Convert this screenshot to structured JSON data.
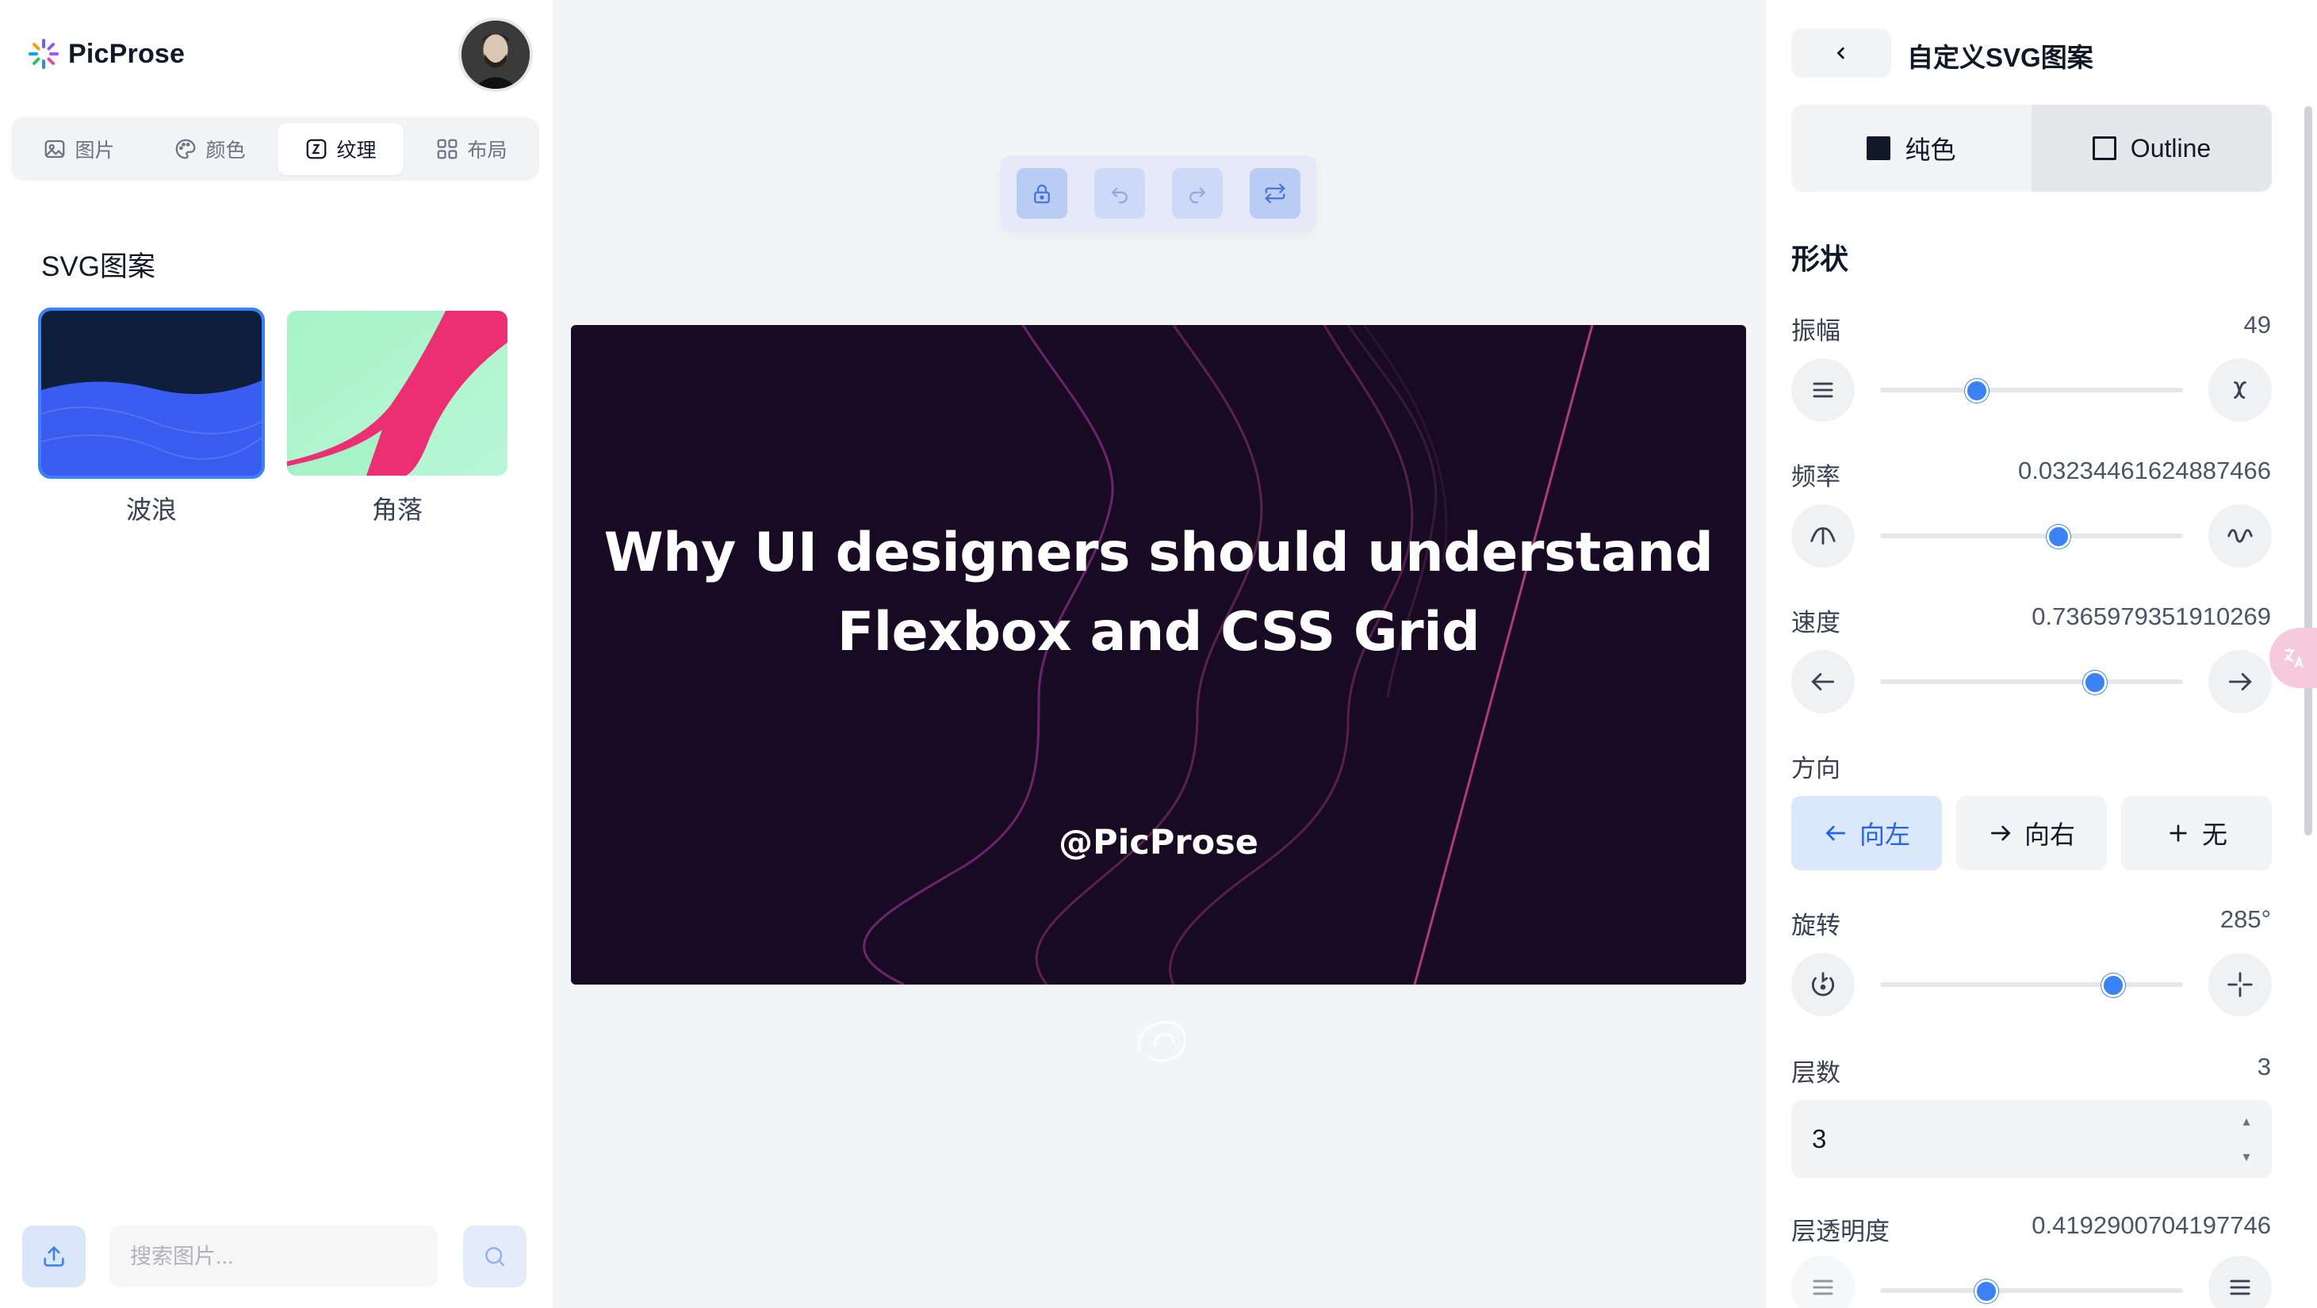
{
  "app": {
    "brand_name": "PicProse"
  },
  "sidebar": {
    "tabs": [
      {
        "label": "图片",
        "icon": "image-icon"
      },
      {
        "label": "颜色",
        "icon": "palette-icon"
      },
      {
        "label": "纹理",
        "icon": "texture-icon",
        "active": true
      },
      {
        "label": "布局",
        "icon": "grid-layout-icon"
      }
    ],
    "section_title": "SVG图案",
    "patterns": [
      {
        "label": "波浪",
        "selected": true
      },
      {
        "label": "角落",
        "selected": false
      }
    ],
    "search_placeholder": "搜索图片..."
  },
  "canvas": {
    "headline_line1": "Why UI designers should understand",
    "headline_line2": "Flexbox and CSS Grid",
    "handle": "@PicProse",
    "background_color": "#190a24"
  },
  "panel": {
    "title": "自定义SVG图案",
    "style_tabs": [
      {
        "label": "纯色",
        "active": false
      },
      {
        "label": "Outline",
        "active": true
      }
    ],
    "shape_title": "形状",
    "amplitude": {
      "label": "振幅",
      "value": "49",
      "slider_fraction": 0.32
    },
    "frequency": {
      "label": "频率",
      "value": "0.03234461624887466",
      "slider_fraction": 0.59
    },
    "speed": {
      "label": "速度",
      "value": "0.7365979351910269",
      "slider_fraction": 0.71
    },
    "direction": {
      "label": "方向",
      "options": [
        {
          "label": "向左",
          "active": true
        },
        {
          "label": "向右",
          "active": false
        },
        {
          "label": "无",
          "active": false
        }
      ]
    },
    "rotation": {
      "label": "旋转",
      "value": "285°",
      "slider_fraction": 0.77
    },
    "layers": {
      "label": "层数",
      "value": "3",
      "input_value": "3"
    },
    "layer_opacity": {
      "label": "层透明度",
      "value": "0.4192900704197746",
      "slider_fraction": 0.35
    }
  },
  "colors": {
    "accent": "#3b82f6",
    "wave_dark": "#0d1f3a",
    "wave_blue": "#3a5cf0",
    "corner_pink": "#ec2f72",
    "corner_mint": "#a7f3c8"
  }
}
